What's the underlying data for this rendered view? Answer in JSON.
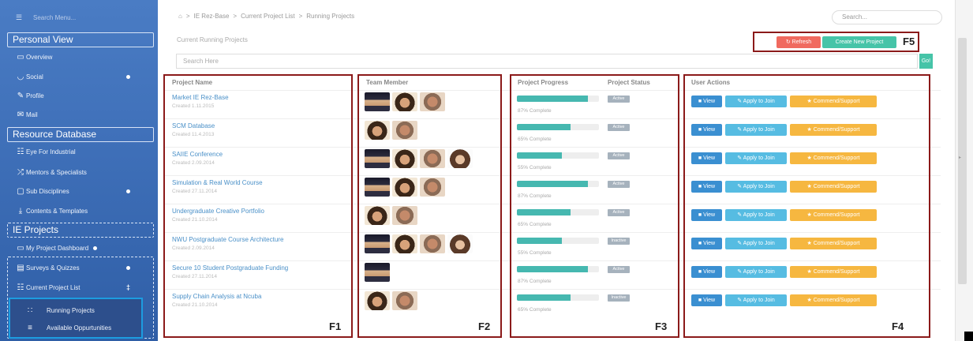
{
  "sidebar": {
    "search_placeholder": "Search Menu...",
    "sections": [
      {
        "title": "Personal View"
      },
      {
        "title": "Resource Database"
      },
      {
        "title": "IE Projects"
      }
    ],
    "personal": [
      {
        "label": "Overview",
        "icon": "monitor-icon"
      },
      {
        "label": "Social",
        "icon": "rss-icon"
      },
      {
        "label": "Profile",
        "icon": "edit-icon"
      },
      {
        "label": "Mail",
        "icon": "envelope-icon"
      }
    ],
    "resource": [
      {
        "label": "Eye For Industrial",
        "icon": "sitemap-icon"
      },
      {
        "label": "Mentors & Specialists",
        "icon": "shuffle-icon"
      },
      {
        "label": "Sub Disciplines",
        "icon": "folder-icon"
      },
      {
        "label": "Contents & Templates",
        "icon": "download-icon"
      }
    ],
    "projects": [
      {
        "label": "My Project Dashboard",
        "icon": "desktop-icon"
      },
      {
        "label": "Surveys & Quizzes",
        "icon": "list-icon"
      },
      {
        "label": "Current Project List",
        "icon": "grid-icon"
      }
    ],
    "sub": [
      {
        "label": "Running Projects",
        "icon": "th-icon"
      },
      {
        "label": "Available Oppurtunities",
        "icon": "bars-icon"
      }
    ]
  },
  "breadcrumb": [
    "IE Rez-Base",
    "Current Project List",
    "Running Projects"
  ],
  "top_search_placeholder": "Search...",
  "panel_title": "Current Running Projects",
  "actions": {
    "refresh": "Refresh",
    "create": "Create New Project",
    "frame_label": "F5"
  },
  "search": {
    "placeholder": "Search Here",
    "go": "Go!"
  },
  "table": {
    "headers": {
      "name": "Project Name",
      "team": "Team Member",
      "progress": "Project Progress",
      "status": "Project Status",
      "actions": "User Actions"
    },
    "buttons": {
      "view": "View",
      "join": "Apply to Join",
      "commend": "Commend/Support"
    },
    "rows": [
      {
        "name": "Market IE Rez-Base",
        "created": "Created 1.11.2015",
        "avatars": [
          "officer",
          "woman",
          "man"
        ],
        "progress": 0.87,
        "progress_text": "87% Complete",
        "status": "Active"
      },
      {
        "name": "SCM Database",
        "created": "Created 11.4.2013",
        "avatars": [
          "woman",
          "man"
        ],
        "progress": 0.65,
        "progress_text": "65% Complete",
        "status": "Active"
      },
      {
        "name": "SAIIE Conference",
        "created": "Created 2.09.2014",
        "avatars": [
          "officer",
          "woman",
          "man",
          "woman2"
        ],
        "progress": 0.55,
        "progress_text": "55% Complete",
        "status": "Active"
      },
      {
        "name": "Simulation & Real World Course",
        "created": "Created 27.11.2014",
        "avatars": [
          "officer",
          "woman",
          "man"
        ],
        "progress": 0.87,
        "progress_text": "87% Complete",
        "status": "Active"
      },
      {
        "name": "Undergraduate Creative Portfolio",
        "created": "Created 21.10.2014",
        "avatars": [
          "woman",
          "man"
        ],
        "progress": 0.65,
        "progress_text": "65% Complete",
        "status": "Active"
      },
      {
        "name": "NWU Postgraduate Course Architecture",
        "created": "Created 2.09.2014",
        "avatars": [
          "officer",
          "woman",
          "man",
          "woman2"
        ],
        "progress": 0.55,
        "progress_text": "55% Complete",
        "status": "Inactive"
      },
      {
        "name": "Secure 10 Student Postgraduate Funding",
        "created": "Created 27.11.2014",
        "avatars": [
          "officer"
        ],
        "progress": 0.87,
        "progress_text": "87% Complete",
        "status": "Active"
      },
      {
        "name": "Supply Chain Analysis at Ncuba",
        "created": "Created 21.10.2014",
        "avatars": [
          "woman",
          "man"
        ],
        "progress": 0.65,
        "progress_text": "65% Complete",
        "status": "Inactive"
      }
    ]
  },
  "frames": {
    "f1": "F1",
    "f2": "F2",
    "f3": "F3",
    "f4": "F4"
  }
}
